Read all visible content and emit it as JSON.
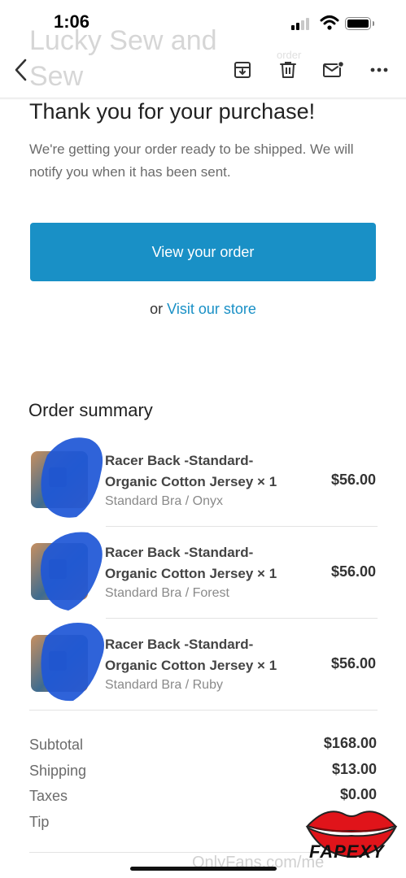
{
  "status_bar": {
    "time": "1:06"
  },
  "email": {
    "sender_name": "Lucky Sew and Sew",
    "sender_meta": "order"
  },
  "toolbar": {
    "back": "back-icon",
    "archive": "archive-icon",
    "delete": "trash-icon",
    "mark_unread": "mail-unread-icon",
    "more": "more-icon"
  },
  "message": {
    "headline": "Thank you for your purchase!",
    "subtext": "We're getting your order ready to be shipped. We will notify you when it has been sent.",
    "cta_label": "View your order",
    "store_prefix": "or",
    "store_link": "Visit our store"
  },
  "order_summary": {
    "title": "Order summary",
    "items": [
      {
        "name": "Racer Back -Standard- Organic Cotton Jersey × 1",
        "variant": "Standard Bra / Onyx",
        "price": "$56.00"
      },
      {
        "name": "Racer Back -Standard- Organic Cotton Jersey × 1",
        "variant": "Standard Bra / Forest",
        "price": "$56.00"
      },
      {
        "name": "Racer Back -Standard- Organic Cotton Jersey × 1",
        "variant": "Standard Bra / Ruby",
        "price": "$56.00"
      }
    ]
  },
  "totals": {
    "subtotal_label": "Subtotal",
    "subtotal": "$168.00",
    "shipping_label": "Shipping",
    "shipping": "$13.00",
    "taxes_label": "Taxes",
    "taxes": "$0.00",
    "tip_label": "Tip"
  },
  "overlay": {
    "watermark": "OnlyFans.com/me",
    "logo": "FAPEXY"
  },
  "colors": {
    "accent": "#1990c6",
    "redaction": "#1f57d6",
    "lips": "#e0141a"
  }
}
